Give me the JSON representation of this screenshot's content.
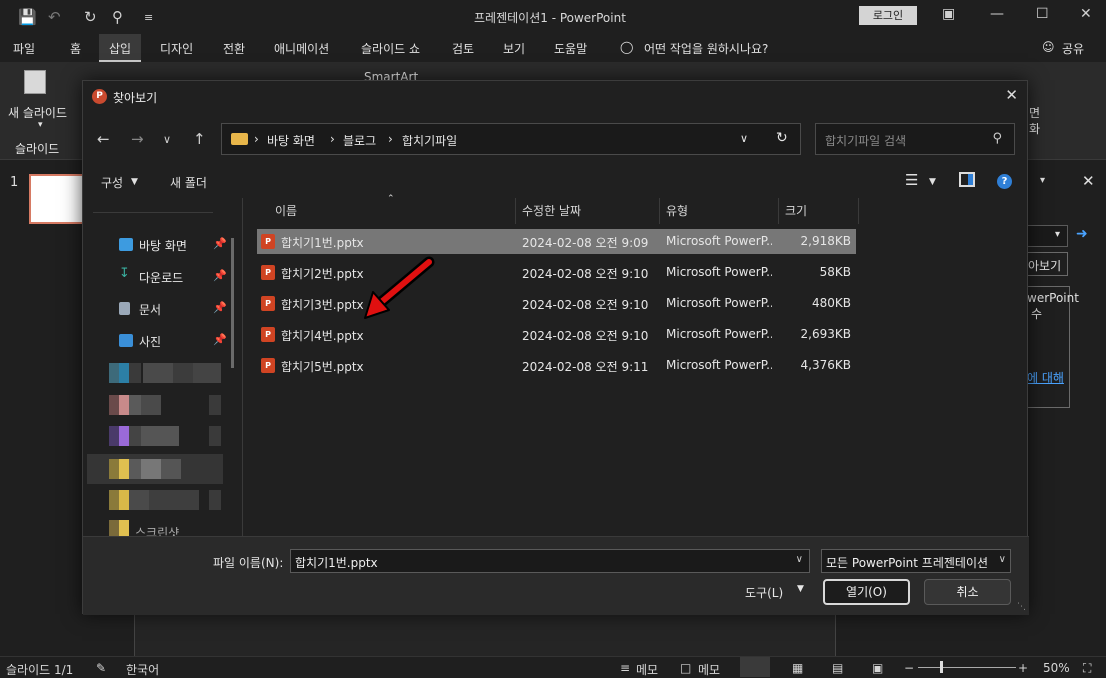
{
  "titlebar": {
    "doc_title": "프레젠테이션1  -  PowerPoint",
    "login": "로그인"
  },
  "menu": {
    "file": "파일",
    "home": "홈",
    "insert": "삽입",
    "design": "디자인",
    "transitions": "전환",
    "animations": "애니메이션",
    "slideshow": "슬라이드 쇼",
    "review": "검토",
    "view": "보기",
    "help": "도움말",
    "tellme": "어떤 작업을 원하시나요?",
    "share": "공유"
  },
  "ribbon": {
    "new_slide": "새 슬라이드",
    "slides_group": "슬라이드",
    "smartart": "SmartArt",
    "right_cut": "면",
    "right_cut2": "화"
  },
  "slides": {
    "num": "1"
  },
  "right_pane": {
    "btn_partial": "아보기",
    "text1": "werPoint",
    "text2": "수",
    "link": "에 대해"
  },
  "statusbar": {
    "slide_count": "슬라이드 1/1",
    "language": "한국어",
    "notes": "메모",
    "comments": "메모",
    "zoom": "50%"
  },
  "dialog": {
    "title": "찾아보기",
    "path": [
      "바탕 화면",
      "블로그",
      "합치기파일"
    ],
    "search_placeholder": "합치기파일 검색",
    "organize": "구성",
    "new_folder": "새 폴더",
    "nav": [
      {
        "label": "바탕 화면",
        "icon": "desktop-icon",
        "color": "#3d9be0"
      },
      {
        "label": "다운로드",
        "icon": "download-icon",
        "color": "#3ab0a0"
      },
      {
        "label": "문서",
        "icon": "document-icon",
        "color": "#9aa8b8"
      },
      {
        "label": "사진",
        "icon": "pictures-icon",
        "color": "#3a8fd8"
      }
    ],
    "nav_partial_label": "스크린샷",
    "columns": {
      "name": "이름",
      "date": "수정한 날짜",
      "type": "유형",
      "size": "크기"
    },
    "files": [
      {
        "name": "합치기1번.pptx",
        "date": "2024-02-08 오전 9:09",
        "type": "Microsoft PowerP...",
        "size": "2,918KB",
        "selected": true
      },
      {
        "name": "합치기2번.pptx",
        "date": "2024-02-08 오전 9:10",
        "type": "Microsoft PowerP...",
        "size": "58KB",
        "selected": false
      },
      {
        "name": "합치기3번.pptx",
        "date": "2024-02-08 오전 9:10",
        "type": "Microsoft PowerP...",
        "size": "480KB",
        "selected": false
      },
      {
        "name": "합치기4번.pptx",
        "date": "2024-02-08 오전 9:10",
        "type": "Microsoft PowerP...",
        "size": "2,693KB",
        "selected": false
      },
      {
        "name": "합치기5번.pptx",
        "date": "2024-02-08 오전 9:11",
        "type": "Microsoft PowerP...",
        "size": "4,376KB",
        "selected": false
      }
    ],
    "filename_label": "파일 이름(N):",
    "filename_value": "합치기1번.pptx",
    "filetype": "모든 PowerPoint 프레젠테이션",
    "tools": "도구(L)",
    "open": "열기(O)",
    "cancel": "취소"
  },
  "colors": {
    "accent_selected": "#777777",
    "ppt_orange": "#d04423",
    "arrow_red": "#e01010"
  }
}
